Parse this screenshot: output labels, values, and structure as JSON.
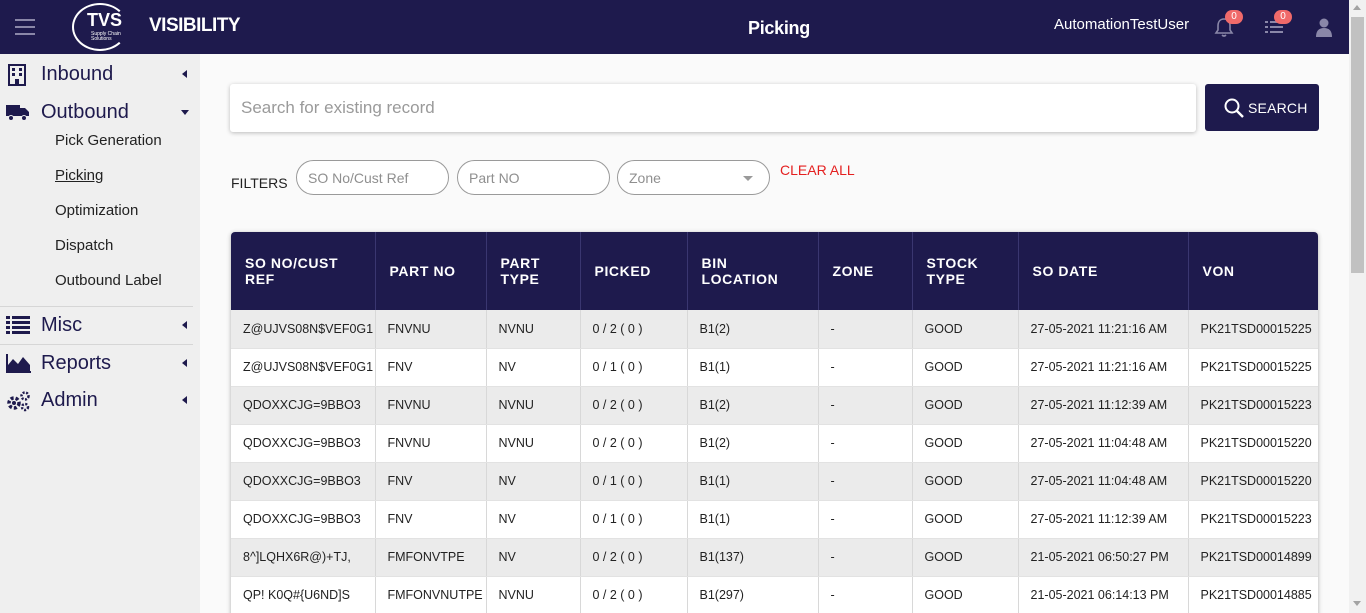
{
  "header": {
    "brand": "VISIBILITY",
    "logo_text": "TVS",
    "logo_subtext": "Supply Chain Solutions",
    "page_title": "Picking",
    "username": "AutomationTestUser",
    "notifications_count": "0",
    "tasks_count": "0"
  },
  "sidebar": {
    "items": [
      {
        "label": "Inbound",
        "icon": "building-icon"
      },
      {
        "label": "Outbound",
        "icon": "truck-icon",
        "expanded": true,
        "subitems": [
          "Pick Generation",
          "Picking",
          "Optimization",
          "Dispatch",
          "Outbound Label"
        ]
      },
      {
        "label": "Misc",
        "icon": "list-icon"
      },
      {
        "label": "Reports",
        "icon": "area-chart-icon"
      },
      {
        "label": "Admin",
        "icon": "gears-icon"
      }
    ],
    "active_subitem": "Picking"
  },
  "search": {
    "placeholder": "Search for existing record",
    "button_label": "SEARCH"
  },
  "filters": {
    "label": "FILTERS",
    "so_placeholder": "SO No/Cust Ref",
    "part_placeholder": "Part NO",
    "zone_placeholder": "Zone",
    "clear_all": "CLEAR ALL"
  },
  "table": {
    "columns": [
      "SO NO/CUST REF",
      "PART NO",
      "PART TYPE",
      "PICKED",
      "BIN LOCATION",
      "ZONE",
      "STOCK TYPE",
      "SO DATE",
      "VON"
    ],
    "rows": [
      [
        "Z@UJVS08N$VEF0G1",
        "FNVNU",
        "NVNU",
        "0 / 2 ( 0 )",
        "B1(2)",
        "-",
        "GOOD",
        "27-05-2021 11:21:16 AM",
        "PK21TSD00015225"
      ],
      [
        "Z@UJVS08N$VEF0G1",
        "FNV",
        "NV",
        "0 / 1 ( 0 )",
        "B1(1)",
        "-",
        "GOOD",
        "27-05-2021 11:21:16 AM",
        "PK21TSD00015225"
      ],
      [
        "QDOXXCJG=9BBO3",
        "FNVNU",
        "NVNU",
        "0 / 2 ( 0 )",
        "B1(2)",
        "-",
        "GOOD",
        "27-05-2021 11:12:39 AM",
        "PK21TSD00015223"
      ],
      [
        "QDOXXCJG=9BBO3",
        "FNVNU",
        "NVNU",
        "0 / 2 ( 0 )",
        "B1(2)",
        "-",
        "GOOD",
        "27-05-2021 11:04:48 AM",
        "PK21TSD00015220"
      ],
      [
        "QDOXXCJG=9BBO3",
        "FNV",
        "NV",
        "0 / 1 ( 0 )",
        "B1(1)",
        "-",
        "GOOD",
        "27-05-2021 11:04:48 AM",
        "PK21TSD00015220"
      ],
      [
        "QDOXXCJG=9BBO3",
        "FNV",
        "NV",
        "0 / 1 ( 0 )",
        "B1(1)",
        "-",
        "GOOD",
        "27-05-2021 11:12:39 AM",
        "PK21TSD00015223"
      ],
      [
        "8^]LQHX6R@)+TJ,",
        "FMFONVTPE",
        "NV",
        "0 / 2 ( 0 )",
        "B1(137)",
        "-",
        "GOOD",
        "21-05-2021 06:50:27 PM",
        "PK21TSD00014899"
      ],
      [
        "QP! K0Q#{U6ND]S",
        "FMFONVNUTPE",
        "NVNU",
        "0 / 2 ( 0 )",
        "B1(297)",
        "-",
        "GOOD",
        "21-05-2021 06:14:13 PM",
        "PK21TSD00014885"
      ]
    ]
  },
  "colors": {
    "primary": "#1e1a4d",
    "danger": "#e41f1f",
    "badge": "#f06a6a",
    "sidebar_bg": "#efefef"
  }
}
